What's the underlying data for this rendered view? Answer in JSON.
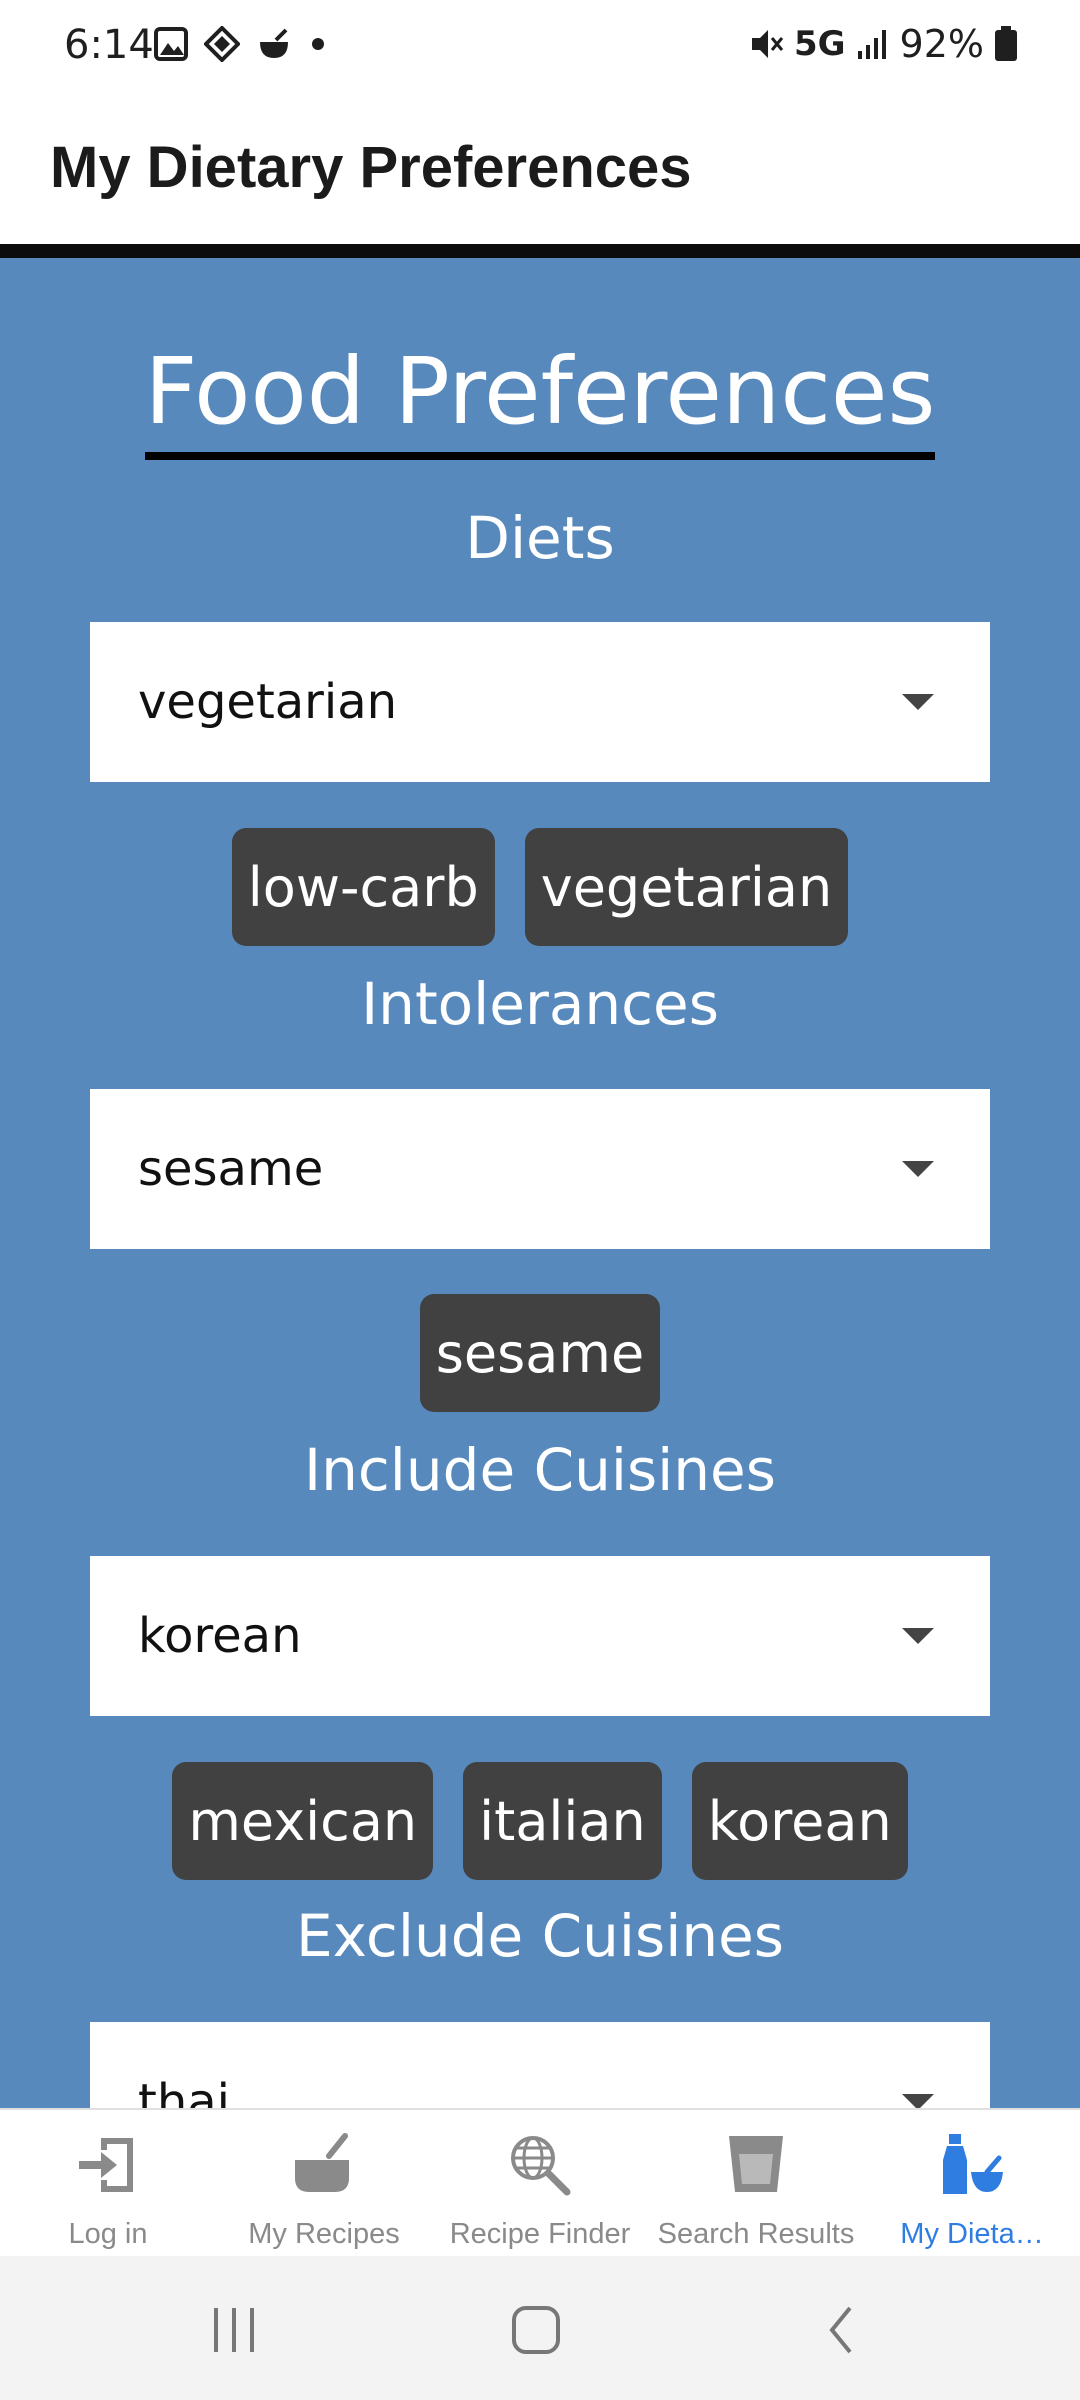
{
  "status_bar": {
    "time": "6:14",
    "network": "5G",
    "battery": "92%"
  },
  "header": {
    "title": "My Dietary Preferences"
  },
  "main": {
    "heading": "Food Preferences",
    "sections": [
      {
        "label": "Diets",
        "selected": "vegetarian",
        "chips": [
          "low-carb",
          "vegetarian"
        ]
      },
      {
        "label": "Intolerances",
        "selected": "sesame",
        "chips": [
          "sesame"
        ]
      },
      {
        "label": "Include Cuisines",
        "selected": "korean",
        "chips": [
          "mexican",
          "italian",
          "korean"
        ]
      },
      {
        "label": "Exclude Cuisines",
        "selected": "thai",
        "chips": []
      }
    ]
  },
  "bottom_nav": {
    "items": [
      {
        "label": "Log in",
        "icon": "login-icon"
      },
      {
        "label": "My Recipes",
        "icon": "pot-icon"
      },
      {
        "label": "Recipe Finder",
        "icon": "globe-search-icon"
      },
      {
        "label": "Search Results",
        "icon": "cup-icon"
      },
      {
        "label": "My Dieta…",
        "icon": "bottle-bowl-icon",
        "active": true
      }
    ]
  },
  "colors": {
    "main_bg": "#5789bd",
    "chip_bg": "#414141",
    "active_nav": "#2f7de1",
    "inactive_nav": "#8a8a8a"
  }
}
